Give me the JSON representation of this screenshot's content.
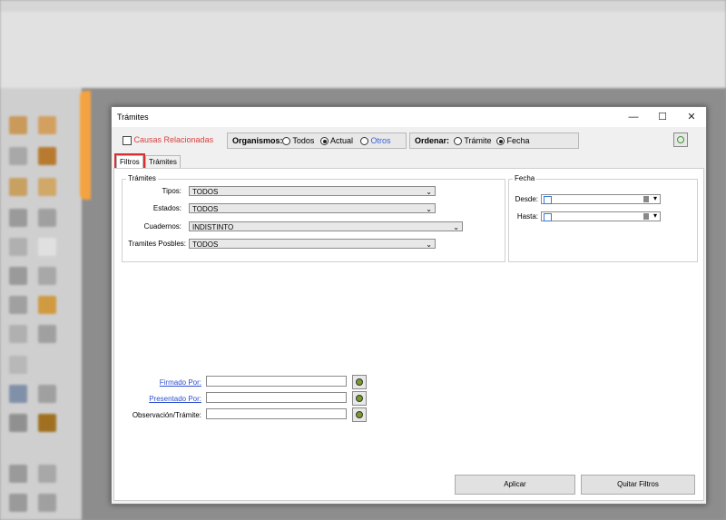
{
  "dialog": {
    "title": "Trámites",
    "controls": {
      "minimize": "—",
      "maximize": "☐",
      "close": "✕"
    }
  },
  "toolbar": {
    "causas_label": "Causas Relacionadas",
    "organismos": {
      "label": "Organismos:",
      "options": [
        "Todos",
        "Actual",
        "Otros"
      ],
      "selected": "Actual"
    },
    "ordenar": {
      "label": "Ordenar:",
      "options": [
        "Trámite",
        "Fecha"
      ],
      "selected": "Fecha"
    },
    "refresh_icon": "refresh-icon",
    "accent_green": "#3a9a2a"
  },
  "tabs": [
    {
      "label": "Filtros",
      "active": true
    },
    {
      "label": "Trámites",
      "active": false
    }
  ],
  "tramites": {
    "legend": "Trámites",
    "fields": [
      {
        "label": "Tipos:",
        "value": "TODOS"
      },
      {
        "label": "Estados:",
        "value": "TODOS"
      },
      {
        "label": "Cuadernos:",
        "value": "INDISTINTO"
      },
      {
        "label": "Tramites Posbles:",
        "value": "TODOS"
      }
    ]
  },
  "fecha": {
    "legend": "Fecha",
    "desde_label": "Desde:",
    "hasta_label": "Hasta:"
  },
  "filters": [
    {
      "label": "Firmado Por:",
      "link": true,
      "value": ""
    },
    {
      "label": "Presentado Por:",
      "link": true,
      "value": ""
    },
    {
      "label": "Observación/Trámite:",
      "link": false,
      "value": ""
    }
  ],
  "buttons": {
    "apply": "Aplicar",
    "clear": "Quitar Filtros"
  }
}
